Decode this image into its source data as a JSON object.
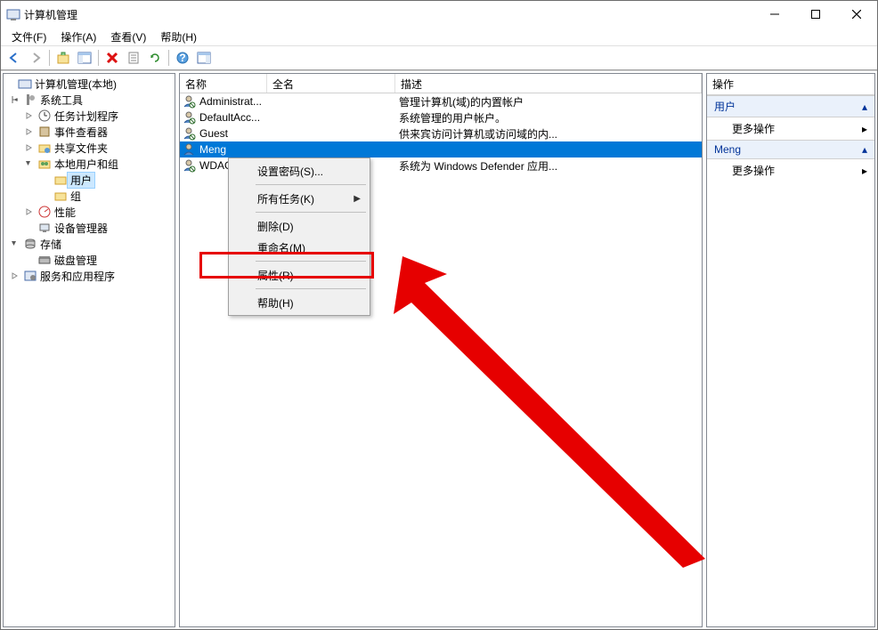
{
  "window": {
    "title": "计算机管理"
  },
  "menubar": {
    "file": "文件(F)",
    "action": "操作(A)",
    "view": "查看(V)",
    "help": "帮助(H)"
  },
  "tree": {
    "root": "计算机管理(本地)",
    "sys_tools": "系统工具",
    "task_scheduler": "任务计划程序",
    "event_viewer": "事件查看器",
    "shared_folders": "共享文件夹",
    "local_users": "本地用户和组",
    "users": "用户",
    "groups": "组",
    "performance": "性能",
    "device_mgr": "设备管理器",
    "storage": "存储",
    "disk_mgmt": "磁盘管理",
    "services_apps": "服务和应用程序"
  },
  "list": {
    "headers": {
      "name": "名称",
      "fullname": "全名",
      "description": "描述"
    },
    "rows": [
      {
        "name": "Administrat...",
        "fullname": "",
        "desc": "管理计算机(域)的内置帐户"
      },
      {
        "name": "DefaultAcc...",
        "fullname": "",
        "desc": "系统管理的用户帐户。"
      },
      {
        "name": "Guest",
        "fullname": "",
        "desc": "供来宾访问计算机或访问域的内..."
      },
      {
        "name": "Meng",
        "fullname": "",
        "desc": ""
      },
      {
        "name": "WDAG...",
        "fullname": "",
        "desc": "系统为 Windows Defender 应用..."
      }
    ]
  },
  "context_menu": {
    "set_password": "设置密码(S)...",
    "all_tasks": "所有任务(K)",
    "delete": "删除(D)",
    "rename": "重命名(M)",
    "properties": "属性(R)",
    "help": "帮助(H)"
  },
  "actions": {
    "header": "操作",
    "section1": "用户",
    "more_actions": "更多操作",
    "section2": "Meng"
  }
}
